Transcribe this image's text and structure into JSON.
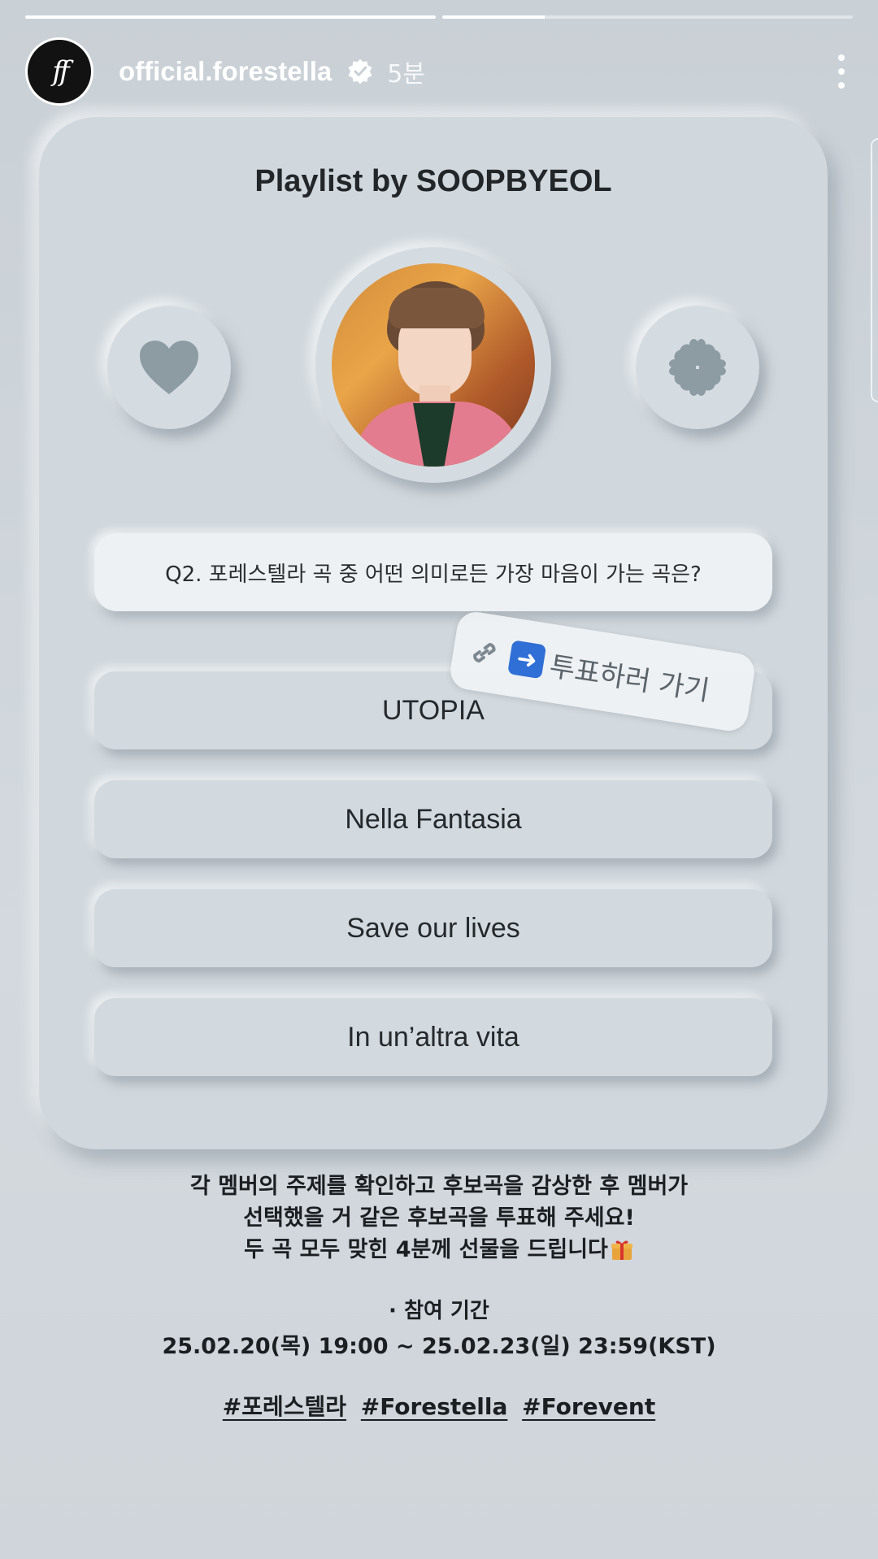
{
  "story": {
    "progress": [
      1.0,
      0.25
    ],
    "username": "official.forestella",
    "time": "5분",
    "avatar_monogram": "ff"
  },
  "card": {
    "title": "Playlist by SOOPBYEOL",
    "icons": [
      "heart-icon",
      "clover-icon"
    ],
    "question": "Q2. 포레스텔라 곡 중 어떤 의미로든 가장 마음이 가는 곡은?",
    "options": [
      "UTOPIA",
      "Nella Fantasia",
      "Save our lives",
      "In un’altra vita"
    ]
  },
  "sticker": {
    "text": "투표하러 가기"
  },
  "caption": {
    "lines": [
      "각 멤버의 주제를 확인하고 후보곡을 감상한 후 멤버가",
      "선택했을 거 같은 후보곡을 투표해 주세요!",
      "두 곡 모두 맞힌 4분께 선물을 드립니다"
    ],
    "period_label": "⋅ 참여 기간",
    "period": "25.02.20(목) 19:00 ~ 25.02.23(일) 23:59(KST)",
    "hashtags": [
      "#포레스텔라",
      "#Forestella",
      "#Forevent"
    ]
  },
  "colors": {
    "accent_blue": "#2f6fd6",
    "icon_gray": "#8d9ba3",
    "jacket_pink": "#e47c8f"
  }
}
